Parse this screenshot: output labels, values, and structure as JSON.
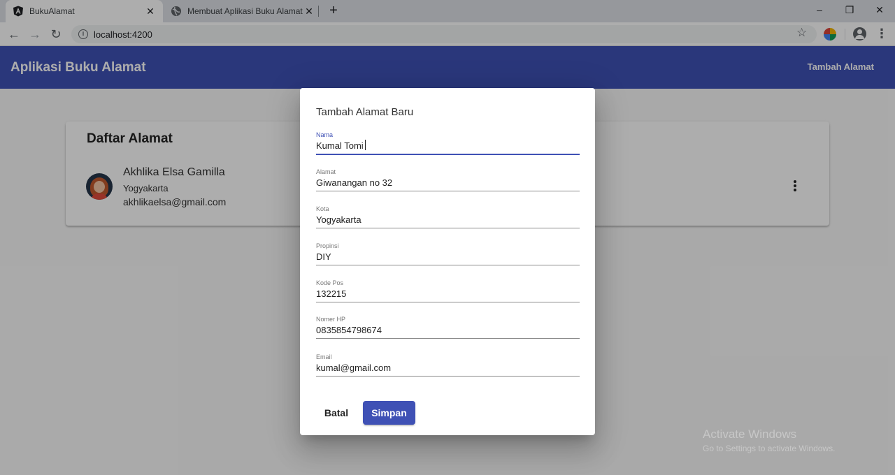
{
  "browser": {
    "tabs": [
      {
        "title": "BukuAlamat",
        "close": "✕"
      },
      {
        "title": "Membuat Aplikasi Buku Alamat M",
        "close": "✕"
      }
    ],
    "new_tab": "+",
    "window": {
      "minimize": "–",
      "restore": "❐",
      "close": "✕"
    },
    "nav": {
      "back": "←",
      "forward": "→",
      "reload": "↻"
    },
    "url": "localhost:4200",
    "star": "☆",
    "menu": "⋮",
    "icons": [
      "angular-favicon",
      "globe-favicon",
      "info-icon",
      "star-icon",
      "extension-icon",
      "profile-icon",
      "menu-icon"
    ]
  },
  "app": {
    "title": "Aplikasi Buku Alamat",
    "toolbar_action": "Tambah Alamat",
    "primary_color": "#3f51b5"
  },
  "list": {
    "heading": "Daftar Alamat",
    "contacts": [
      {
        "name": "Akhlika Elsa Gamilla",
        "city": "Yogyakarta",
        "email": "akhlikaelsa@gmail.com"
      }
    ]
  },
  "dialog": {
    "title": "Tambah Alamat Baru",
    "fields": [
      {
        "label": "Nama",
        "value": "Kumal Tomi",
        "focused": true
      },
      {
        "label": "Alamat",
        "value": "Giwanangan no 32"
      },
      {
        "label": "Kota",
        "value": "Yogyakarta"
      },
      {
        "label": "Propinsi",
        "value": "DIY"
      },
      {
        "label": "Kode Pos",
        "value": "132215"
      },
      {
        "label": "Nomer HP",
        "value": "0835854798674"
      },
      {
        "label": "Email",
        "value": "kumal@gmail.com"
      }
    ],
    "cancel_label": "Batal",
    "save_label": "Simpan"
  },
  "watermark": {
    "line1": "Activate Windows",
    "line2": "Go to Settings to activate Windows."
  }
}
